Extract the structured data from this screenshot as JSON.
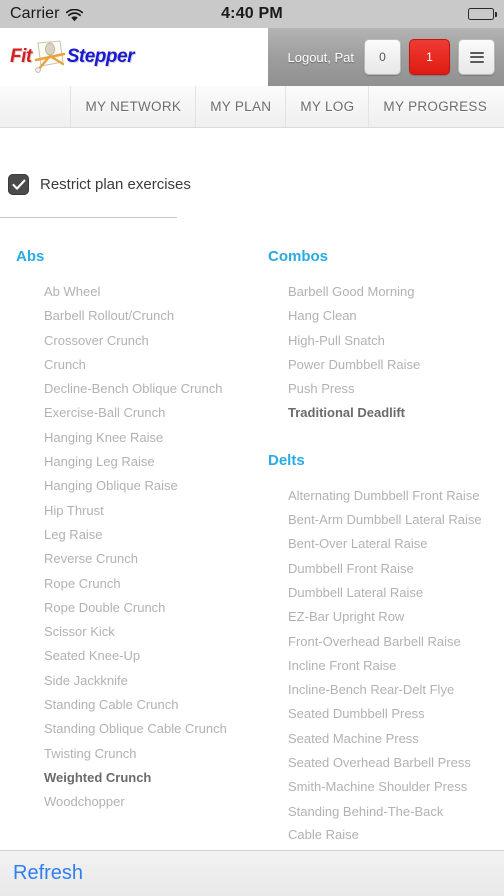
{
  "status_bar": {
    "carrier": "Carrier",
    "wifi_icon": "wifi-icon",
    "time": "4:40 PM",
    "battery_icon": "battery-full-icon"
  },
  "header": {
    "logo_first": "Fit",
    "logo_second": "Stepper",
    "logo_mark_icon": "stepper-machine-icon",
    "logout_label": "Logout, Pat",
    "count_button_label": "0",
    "alert_button_label": "1",
    "menu_button_icon": "hamburger-menu-icon",
    "accent_red": "#e01b12"
  },
  "nav": {
    "items": [
      {
        "label": "MY NETWORK"
      },
      {
        "label": "MY PLAN"
      },
      {
        "label": "MY LOG"
      },
      {
        "label": "MY PROGRESS"
      }
    ]
  },
  "filter": {
    "checkbox_icon": "checkmark-icon",
    "checked": true,
    "label": "Restrict plan exercises"
  },
  "theme": {
    "group_heading_color": "#29abe2",
    "item_color": "#b2b2b2",
    "selected_item_color": "#6b6b6b",
    "link_color": "#2f7ff0"
  },
  "groups": [
    {
      "name": "Abs",
      "column": 1,
      "exercises": [
        {
          "label": "Ab Wheel",
          "selected": false
        },
        {
          "label": "Barbell Rollout/Crunch",
          "selected": false
        },
        {
          "label": "Crossover Crunch",
          "selected": false
        },
        {
          "label": "Crunch",
          "selected": false
        },
        {
          "label": "Decline-Bench Oblique Crunch",
          "selected": false
        },
        {
          "label": "Exercise-Ball Crunch",
          "selected": false
        },
        {
          "label": "Hanging Knee Raise",
          "selected": false
        },
        {
          "label": "Hanging Leg Raise",
          "selected": false
        },
        {
          "label": "Hanging Oblique Raise",
          "selected": false
        },
        {
          "label": "Hip Thrust",
          "selected": false
        },
        {
          "label": "Leg Raise",
          "selected": false
        },
        {
          "label": "Reverse Crunch",
          "selected": false
        },
        {
          "label": "Rope Crunch",
          "selected": false
        },
        {
          "label": "Rope Double Crunch",
          "selected": false
        },
        {
          "label": "Scissor Kick",
          "selected": false
        },
        {
          "label": "Seated Knee-Up",
          "selected": false
        },
        {
          "label": "Side Jackknife",
          "selected": false
        },
        {
          "label": "Standing Cable Crunch",
          "selected": false
        },
        {
          "label": "Standing Oblique Cable Crunch",
          "selected": false
        },
        {
          "label": "Twisting Crunch",
          "selected": false
        },
        {
          "label": "Weighted Crunch",
          "selected": true
        },
        {
          "label": "Woodchopper",
          "selected": false
        }
      ]
    },
    {
      "name": "Combos",
      "column": 2,
      "exercises": [
        {
          "label": "Barbell Good Morning",
          "selected": false
        },
        {
          "label": "Hang Clean",
          "selected": false
        },
        {
          "label": "High-Pull Snatch",
          "selected": false
        },
        {
          "label": "Power Dumbbell Raise",
          "selected": false
        },
        {
          "label": "Push Press",
          "selected": false
        },
        {
          "label": "Traditional Deadlift",
          "selected": true
        }
      ]
    },
    {
      "name": "Delts",
      "column": 2,
      "exercises": [
        {
          "label": "Alternating Dumbbell Front Raise",
          "selected": false
        },
        {
          "label": "Bent-Arm Dumbbell Lateral Raise",
          "selected": false
        },
        {
          "label": "Bent-Over Lateral Raise",
          "selected": false
        },
        {
          "label": "Dumbbell Front Raise",
          "selected": false
        },
        {
          "label": "Dumbbell Lateral Raise",
          "selected": false
        },
        {
          "label": "EZ-Bar Upright Row",
          "selected": false
        },
        {
          "label": "Front-Overhead Barbell Raise",
          "selected": false
        },
        {
          "label": "Incline Front Raise",
          "selected": false
        },
        {
          "label": "Incline-Bench Rear-Delt Flye",
          "selected": false
        },
        {
          "label": "Seated Dumbbell Press",
          "selected": false
        },
        {
          "label": "Seated Machine Press",
          "selected": false
        },
        {
          "label": "Seated Overhead Barbell Press",
          "selected": false
        },
        {
          "label": "Smith-Machine Shoulder Press",
          "selected": false
        },
        {
          "label": "Standing Behind-The-Back Cable Raise",
          "selected": false,
          "wrap": true
        }
      ]
    }
  ],
  "footer": {
    "refresh_label": "Refresh"
  }
}
